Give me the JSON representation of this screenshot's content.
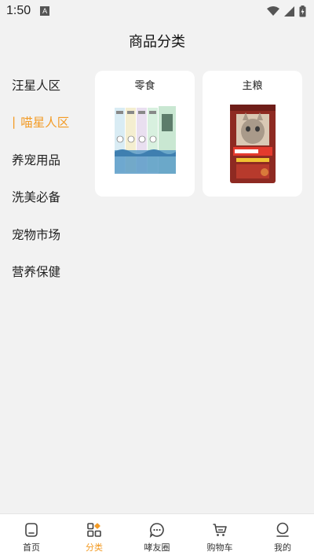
{
  "status_bar": {
    "time": "1:50",
    "badge": "A"
  },
  "header": {
    "title": "商品分类"
  },
  "sidebar": {
    "active_marker": "|",
    "items": [
      {
        "label": "汪星人区",
        "active": false
      },
      {
        "label": "喵星人区",
        "active": true
      },
      {
        "label": "养宠用品",
        "active": false
      },
      {
        "label": "洗美必备",
        "active": false
      },
      {
        "label": "宠物市场",
        "active": false
      },
      {
        "label": "营养保健",
        "active": false
      }
    ]
  },
  "categories": [
    {
      "label": "零食",
      "image": "cat-snack-strips"
    },
    {
      "label": "主粮",
      "image": "cat-food-bag"
    }
  ],
  "tabbar": {
    "items": [
      {
        "label": "首页",
        "icon": "home-icon",
        "active": false
      },
      {
        "label": "分类",
        "icon": "grid-icon",
        "active": true
      },
      {
        "label": "哮友圈",
        "icon": "chat-icon",
        "active": false
      },
      {
        "label": "购物车",
        "icon": "cart-icon",
        "active": false
      },
      {
        "label": "我的",
        "icon": "profile-icon",
        "active": false
      }
    ]
  },
  "colors": {
    "accent": "#f39b25",
    "background": "#f2f2f2",
    "card": "#ffffff"
  }
}
